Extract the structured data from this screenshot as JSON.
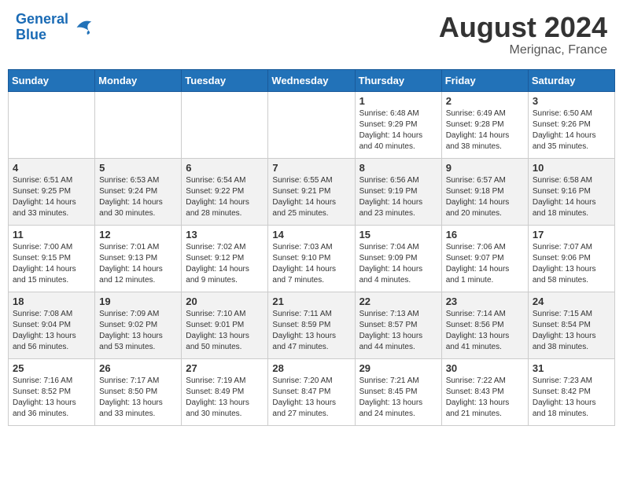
{
  "header": {
    "logo_line1": "General",
    "logo_line2": "Blue",
    "month_title": "August 2024",
    "location": "Merignac, France"
  },
  "days_of_week": [
    "Sunday",
    "Monday",
    "Tuesday",
    "Wednesday",
    "Thursday",
    "Friday",
    "Saturday"
  ],
  "weeks": [
    [
      {
        "day": "",
        "info": ""
      },
      {
        "day": "",
        "info": ""
      },
      {
        "day": "",
        "info": ""
      },
      {
        "day": "",
        "info": ""
      },
      {
        "day": "1",
        "info": "Sunrise: 6:48 AM\nSunset: 9:29 PM\nDaylight: 14 hours\nand 40 minutes."
      },
      {
        "day": "2",
        "info": "Sunrise: 6:49 AM\nSunset: 9:28 PM\nDaylight: 14 hours\nand 38 minutes."
      },
      {
        "day": "3",
        "info": "Sunrise: 6:50 AM\nSunset: 9:26 PM\nDaylight: 14 hours\nand 35 minutes."
      }
    ],
    [
      {
        "day": "4",
        "info": "Sunrise: 6:51 AM\nSunset: 9:25 PM\nDaylight: 14 hours\nand 33 minutes."
      },
      {
        "day": "5",
        "info": "Sunrise: 6:53 AM\nSunset: 9:24 PM\nDaylight: 14 hours\nand 30 minutes."
      },
      {
        "day": "6",
        "info": "Sunrise: 6:54 AM\nSunset: 9:22 PM\nDaylight: 14 hours\nand 28 minutes."
      },
      {
        "day": "7",
        "info": "Sunrise: 6:55 AM\nSunset: 9:21 PM\nDaylight: 14 hours\nand 25 minutes."
      },
      {
        "day": "8",
        "info": "Sunrise: 6:56 AM\nSunset: 9:19 PM\nDaylight: 14 hours\nand 23 minutes."
      },
      {
        "day": "9",
        "info": "Sunrise: 6:57 AM\nSunset: 9:18 PM\nDaylight: 14 hours\nand 20 minutes."
      },
      {
        "day": "10",
        "info": "Sunrise: 6:58 AM\nSunset: 9:16 PM\nDaylight: 14 hours\nand 18 minutes."
      }
    ],
    [
      {
        "day": "11",
        "info": "Sunrise: 7:00 AM\nSunset: 9:15 PM\nDaylight: 14 hours\nand 15 minutes."
      },
      {
        "day": "12",
        "info": "Sunrise: 7:01 AM\nSunset: 9:13 PM\nDaylight: 14 hours\nand 12 minutes."
      },
      {
        "day": "13",
        "info": "Sunrise: 7:02 AM\nSunset: 9:12 PM\nDaylight: 14 hours\nand 9 minutes."
      },
      {
        "day": "14",
        "info": "Sunrise: 7:03 AM\nSunset: 9:10 PM\nDaylight: 14 hours\nand 7 minutes."
      },
      {
        "day": "15",
        "info": "Sunrise: 7:04 AM\nSunset: 9:09 PM\nDaylight: 14 hours\nand 4 minutes."
      },
      {
        "day": "16",
        "info": "Sunrise: 7:06 AM\nSunset: 9:07 PM\nDaylight: 14 hours\nand 1 minute."
      },
      {
        "day": "17",
        "info": "Sunrise: 7:07 AM\nSunset: 9:06 PM\nDaylight: 13 hours\nand 58 minutes."
      }
    ],
    [
      {
        "day": "18",
        "info": "Sunrise: 7:08 AM\nSunset: 9:04 PM\nDaylight: 13 hours\nand 56 minutes."
      },
      {
        "day": "19",
        "info": "Sunrise: 7:09 AM\nSunset: 9:02 PM\nDaylight: 13 hours\nand 53 minutes."
      },
      {
        "day": "20",
        "info": "Sunrise: 7:10 AM\nSunset: 9:01 PM\nDaylight: 13 hours\nand 50 minutes."
      },
      {
        "day": "21",
        "info": "Sunrise: 7:11 AM\nSunset: 8:59 PM\nDaylight: 13 hours\nand 47 minutes."
      },
      {
        "day": "22",
        "info": "Sunrise: 7:13 AM\nSunset: 8:57 PM\nDaylight: 13 hours\nand 44 minutes."
      },
      {
        "day": "23",
        "info": "Sunrise: 7:14 AM\nSunset: 8:56 PM\nDaylight: 13 hours\nand 41 minutes."
      },
      {
        "day": "24",
        "info": "Sunrise: 7:15 AM\nSunset: 8:54 PM\nDaylight: 13 hours\nand 38 minutes."
      }
    ],
    [
      {
        "day": "25",
        "info": "Sunrise: 7:16 AM\nSunset: 8:52 PM\nDaylight: 13 hours\nand 36 minutes."
      },
      {
        "day": "26",
        "info": "Sunrise: 7:17 AM\nSunset: 8:50 PM\nDaylight: 13 hours\nand 33 minutes."
      },
      {
        "day": "27",
        "info": "Sunrise: 7:19 AM\nSunset: 8:49 PM\nDaylight: 13 hours\nand 30 minutes."
      },
      {
        "day": "28",
        "info": "Sunrise: 7:20 AM\nSunset: 8:47 PM\nDaylight: 13 hours\nand 27 minutes."
      },
      {
        "day": "29",
        "info": "Sunrise: 7:21 AM\nSunset: 8:45 PM\nDaylight: 13 hours\nand 24 minutes."
      },
      {
        "day": "30",
        "info": "Sunrise: 7:22 AM\nSunset: 8:43 PM\nDaylight: 13 hours\nand 21 minutes."
      },
      {
        "day": "31",
        "info": "Sunrise: 7:23 AM\nSunset: 8:42 PM\nDaylight: 13 hours\nand 18 minutes."
      }
    ]
  ]
}
